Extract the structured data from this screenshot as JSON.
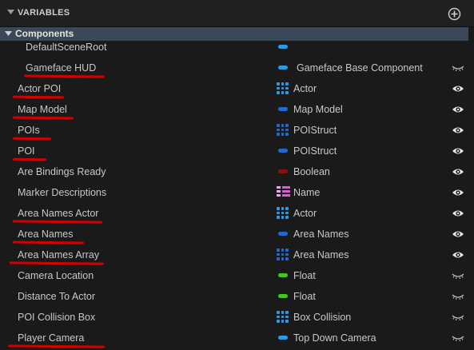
{
  "panel": {
    "title": "VARIABLES",
    "add_tooltip_icon": "plus-circle-icon"
  },
  "section": {
    "label": "Components"
  },
  "colors": {
    "object": "#2a9be6",
    "struct": "#1f6bd1",
    "boolean": "#8b1010",
    "name": "#d65fd6",
    "float": "#45c81e",
    "underline": "#d40000"
  },
  "rows": [
    {
      "name": "DefaultSceneRoot",
      "type": "",
      "icon": "pill-object",
      "visibility": "none",
      "indent": 1,
      "underlined": false
    },
    {
      "name": "Gameface HUD",
      "type": "Gameface Base Component",
      "icon": "pill-object",
      "visibility": "private-eye",
      "indent": 1,
      "underlined": true
    },
    {
      "name": "Actor POI",
      "type": "Actor",
      "icon": "array-object",
      "visibility": "public-eye",
      "indent": 0,
      "underlined": true
    },
    {
      "name": "Map Model",
      "type": "Map Model",
      "icon": "pill-struct",
      "visibility": "public-eye",
      "indent": 0,
      "underlined": true
    },
    {
      "name": "POIs",
      "type": "POIStruct",
      "icon": "array-struct",
      "visibility": "public-eye",
      "indent": 0,
      "underlined": true
    },
    {
      "name": "POI",
      "type": "POIStruct",
      "icon": "pill-struct",
      "visibility": "public-eye",
      "indent": 0,
      "underlined": true
    },
    {
      "name": "Are Bindings Ready",
      "type": "Boolean",
      "icon": "pill-boolean",
      "visibility": "public-eye",
      "indent": 0,
      "underlined": false
    },
    {
      "name": "Marker Descriptions",
      "type": "Name",
      "icon": "map-name",
      "visibility": "public-eye",
      "indent": 0,
      "underlined": false
    },
    {
      "name": "Area Names Actor",
      "type": "Actor",
      "icon": "array-object",
      "visibility": "public-eye",
      "indent": 0,
      "underlined": true
    },
    {
      "name": "Area Names",
      "type": "Area Names",
      "icon": "pill-struct",
      "visibility": "public-eye",
      "indent": 0,
      "underlined": true
    },
    {
      "name": "Area Names Array",
      "type": "Area Names",
      "icon": "array-struct",
      "visibility": "public-eye",
      "indent": 0,
      "underlined": true
    },
    {
      "name": "Camera Location",
      "type": "Float",
      "icon": "pill-float",
      "visibility": "private-eye",
      "indent": 0,
      "underlined": false
    },
    {
      "name": "Distance To Actor",
      "type": "Float",
      "icon": "pill-float",
      "visibility": "private-eye",
      "indent": 0,
      "underlined": false
    },
    {
      "name": "POI Collision Box",
      "type": "Box Collision",
      "icon": "array-object",
      "visibility": "private-eye",
      "indent": 0,
      "underlined": false
    },
    {
      "name": "Player Camera",
      "type": "Top Down Camera",
      "icon": "pill-object",
      "visibility": "private-eye",
      "indent": 0,
      "underlined": true
    }
  ]
}
